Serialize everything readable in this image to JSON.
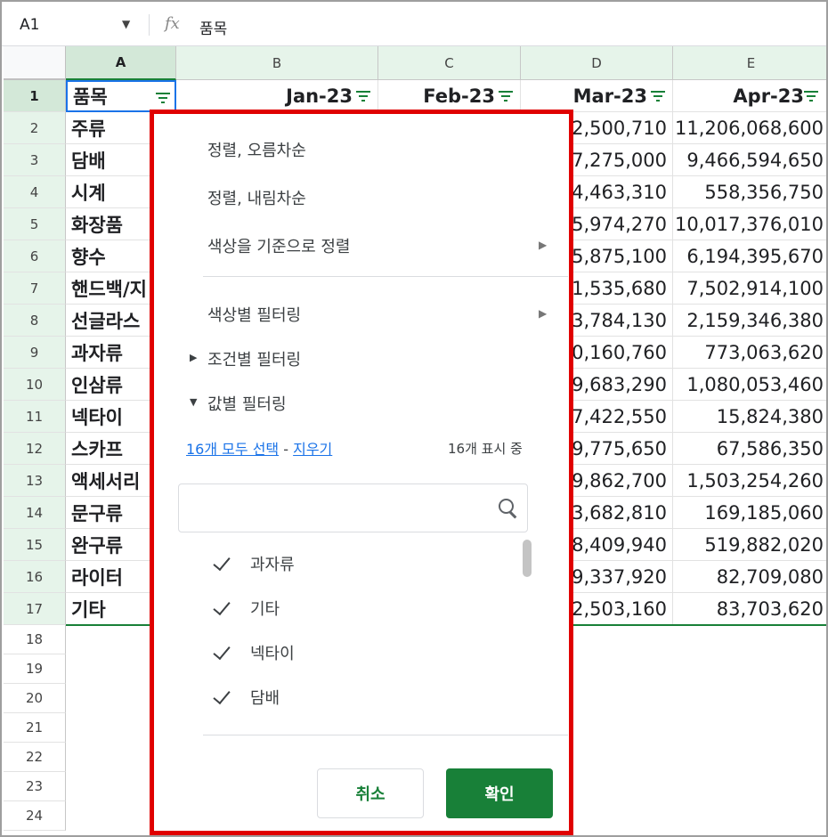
{
  "formula_bar": {
    "cell_ref": "A1",
    "fx": "fx",
    "value": "품목"
  },
  "columns": [
    "A",
    "B",
    "C",
    "D",
    "E"
  ],
  "header_row": {
    "a": "품목",
    "b": "Jan-23",
    "c": "Feb-23",
    "d": "Mar-23",
    "e": "Apr-23"
  },
  "rows": [
    {
      "num": "2",
      "item": "주류",
      "d": "2,500,710",
      "e": "11,206,068,600"
    },
    {
      "num": "3",
      "item": "담배",
      "d": "7,275,000",
      "e": "9,466,594,650"
    },
    {
      "num": "4",
      "item": "시계",
      "d": "4,463,310",
      "e": "558,356,750"
    },
    {
      "num": "5",
      "item": "화장품",
      "d": "5,974,270",
      "e": "10,017,376,010"
    },
    {
      "num": "6",
      "item": "향수",
      "d": "5,875,100",
      "e": "6,194,395,670"
    },
    {
      "num": "7",
      "item": "핸드백/지",
      "d": "1,535,680",
      "e": "7,502,914,100"
    },
    {
      "num": "8",
      "item": "선글라스",
      "d": "3,784,130",
      "e": "2,159,346,380"
    },
    {
      "num": "9",
      "item": "과자류",
      "d": "0,160,760",
      "e": "773,063,620"
    },
    {
      "num": "10",
      "item": "인삼류",
      "d": "9,683,290",
      "e": "1,080,053,460"
    },
    {
      "num": "11",
      "item": "넥타이",
      "d": "7,422,550",
      "e": "15,824,380"
    },
    {
      "num": "12",
      "item": "스카프",
      "d": "9,775,650",
      "e": "67,586,350"
    },
    {
      "num": "13",
      "item": "액세서리",
      "d": "9,862,700",
      "e": "1,503,254,260"
    },
    {
      "num": "14",
      "item": "문구류",
      "d": "3,682,810",
      "e": "169,185,060"
    },
    {
      "num": "15",
      "item": "완구류",
      "d": "8,409,940",
      "e": "519,882,020"
    },
    {
      "num": "16",
      "item": "라이터",
      "d": "9,337,920",
      "e": "82,709,080"
    },
    {
      "num": "17",
      "item": "기타",
      "d": "2,503,160",
      "e": "83,703,620"
    }
  ],
  "empty_rows": [
    "18",
    "19",
    "20",
    "21",
    "22",
    "23",
    "24"
  ],
  "row1_num": "1",
  "filter_menu": {
    "sort_asc": "정렬, 오름차순",
    "sort_desc": "정렬, 내림차순",
    "sort_by_color": "색상을 기준으로 정렬",
    "filter_by_color": "색상별 필터링",
    "filter_by_condition": "조건별 필터링",
    "filter_by_values": "값별 필터링",
    "select_all": "16개 모두 선택",
    "dash": "-",
    "clear": "지우기",
    "showing_count": "16개 표시 중",
    "values": [
      "과자류",
      "기타",
      "넥타이",
      "담배"
    ],
    "cancel": "취소",
    "ok": "확인"
  },
  "colors": {
    "accent_green": "#188038",
    "highlight_red": "#e00000",
    "link_blue": "#1a73e8"
  }
}
